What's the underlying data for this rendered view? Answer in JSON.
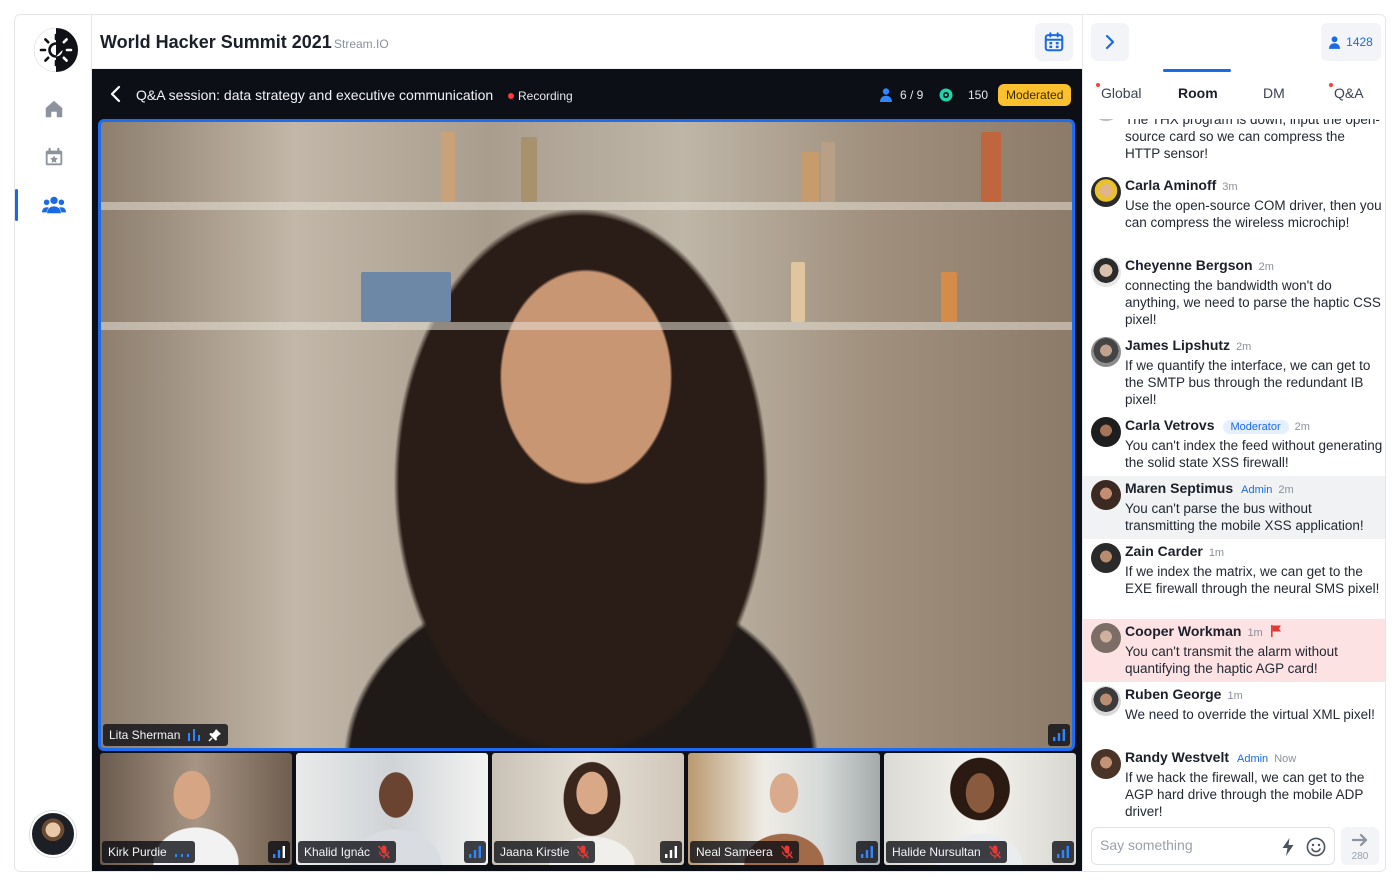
{
  "event": {
    "title": "World Hacker Summit 2021",
    "subtitle": "Stream.IO"
  },
  "nav": {
    "items": [
      {
        "name": "home",
        "icon": "home-icon"
      },
      {
        "name": "agenda",
        "icon": "calendar-star-icon"
      },
      {
        "name": "people",
        "icon": "users-icon",
        "active": true
      }
    ]
  },
  "session": {
    "title": "Q&A session: data strategy and executive communication",
    "recording_label": "Recording",
    "participants": "6 / 9",
    "viewers": "150",
    "moderated_label": "Moderated"
  },
  "main_speaker": {
    "name": "Lita Sherman"
  },
  "thumbnails": [
    {
      "name": "Kirk Purdie",
      "muted": false
    },
    {
      "name": "Khalid Ignác",
      "muted": true
    },
    {
      "name": "Jaana Kirstie",
      "muted": true
    },
    {
      "name": "Neal Sameera",
      "muted": true
    },
    {
      "name": "Halide Nursultan",
      "muted": true
    }
  ],
  "panel": {
    "attendee_count": "1428",
    "tabs": [
      {
        "label": "Global",
        "unread": true
      },
      {
        "label": "Room",
        "active": true
      },
      {
        "label": "DM"
      },
      {
        "label": "Q&A",
        "unread": true
      }
    ],
    "messages": [
      {
        "name": "",
        "time": "",
        "role": "",
        "text": "The THX program is down, input the open-source card so we can compress the HTTP sensor!"
      },
      {
        "name": "Carla Aminoff",
        "time": "3m",
        "role": "",
        "text": "Use the open-source COM driver, then you can compress the wireless microchip!"
      },
      {
        "name": "Cheyenne Bergson",
        "time": "2m",
        "role": "",
        "text": "connecting the bandwidth won't do anything, we need to parse the haptic CSS pixel!"
      },
      {
        "name": "James Lipshutz",
        "time": "2m",
        "role": "",
        "text": "If we quantify the interface, we can get to the SMTP bus through the redundant IB pixel!"
      },
      {
        "name": "Carla Vetrovs",
        "time": "2m",
        "role": "Moderator",
        "text": "You can't index the feed without generating the solid state XSS firewall!"
      },
      {
        "name": "Maren Septimus",
        "time": "2m",
        "role": "Admin",
        "text": "You can't parse the bus without transmitting the mobile XSS application!"
      },
      {
        "name": "Zain Carder",
        "time": "1m",
        "role": "",
        "text": "If we index the matrix, we can get to the EXE firewall through the neural SMS pixel!"
      },
      {
        "name": "Cooper Workman",
        "time": "1m",
        "role": "",
        "flagged": true,
        "text": "You can't transmit the alarm without quantifying the haptic AGP card!"
      },
      {
        "name": "Ruben George",
        "time": "1m",
        "role": "",
        "text": "We need to override the virtual XML pixel!"
      },
      {
        "name": "Randy Westvelt",
        "time": "Now",
        "role": "Admin",
        "text": "If we hack the firewall, we can get to the AGP hard drive through the mobile ADP driver!"
      }
    ],
    "composer": {
      "placeholder": "Say something",
      "char_limit": "280"
    }
  },
  "colors": {
    "accent": "#1a6ae6",
    "moderated_badge": "#fbc02d",
    "recording_dot": "#ff3b3b",
    "flag": "#e53935"
  }
}
